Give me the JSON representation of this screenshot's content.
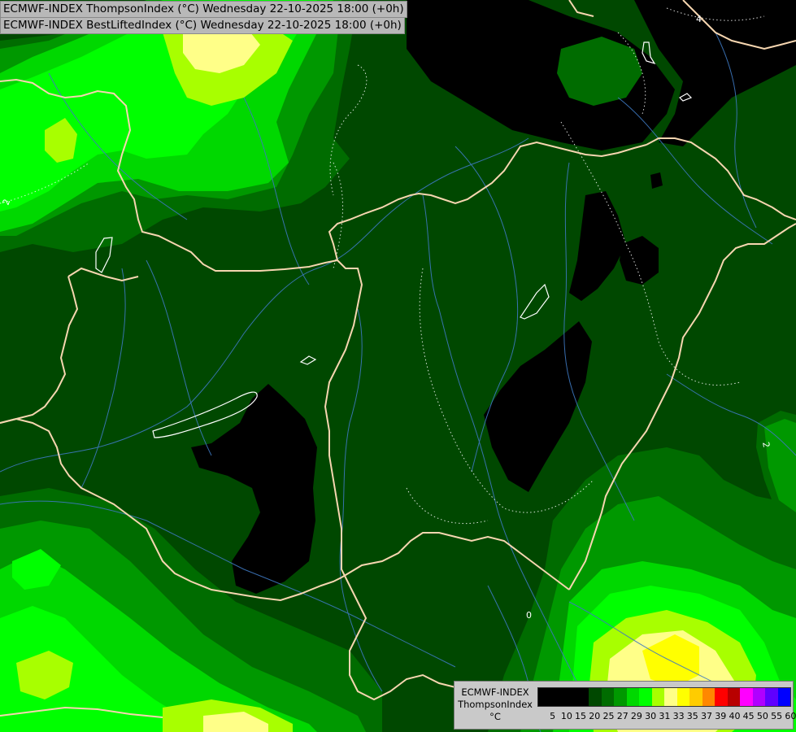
{
  "map": {
    "title_line_1": "ECMWF-INDEX ThompsonIndex (°C) Wednesday 22-10-2025 18:00 (+0h)",
    "title_line_2": "ECMWF-INDEX BestLiftedIndex (°C) Wednesday 22-10-2025 18:00 (+0h)",
    "contour_labels": [
      "2",
      "2",
      "4",
      "0"
    ]
  },
  "legend": {
    "model": "ECMWF-INDEX",
    "parameter": "ThompsonIndex",
    "unit": "°C",
    "ticks": [
      "5",
      "10",
      "15",
      "20",
      "25",
      "27",
      "29",
      "30",
      "31",
      "33",
      "35",
      "37",
      "39",
      "40",
      "45",
      "50",
      "55",
      "60"
    ],
    "colors": [
      "#000000",
      "#000000",
      "#000000",
      "#000000",
      "#004800",
      "#006c00",
      "#009800",
      "#00d800",
      "#00ff00",
      "#a8ff00",
      "#ffff88",
      "#ffff00",
      "#ffcc00",
      "#ff8800",
      "#ff0000",
      "#b80000",
      "#ff00ff",
      "#b000ff",
      "#6000ff",
      "#0000ff"
    ]
  }
}
